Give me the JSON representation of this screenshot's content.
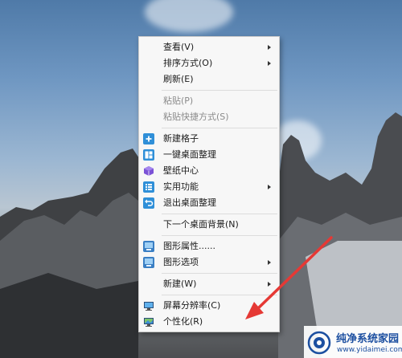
{
  "menu": {
    "items": [
      {
        "label": "查看(V)"
      },
      {
        "label": "排序方式(O)"
      },
      {
        "label": "刷新(E)"
      },
      {
        "label": "粘贴(P)"
      },
      {
        "label": "粘贴快捷方式(S)"
      },
      {
        "label": "新建格子"
      },
      {
        "label": "一键桌面整理"
      },
      {
        "label": "壁纸中心"
      },
      {
        "label": "实用功能"
      },
      {
        "label": "退出桌面整理"
      },
      {
        "label": "下一个桌面背景(N)"
      },
      {
        "label": "图形属性......"
      },
      {
        "label": "图形选项"
      },
      {
        "label": "新建(W)"
      },
      {
        "label": "屏幕分辨率(C)"
      },
      {
        "label": "个性化(R)"
      }
    ]
  },
  "icons": {
    "new_grid": "plus-square-icon",
    "desktop_organize": "layout-grid-icon",
    "wallpaper_center": "cube-icon",
    "utilities": "list-icon",
    "exit_organize": "undo-icon",
    "graphics_properties": "graphics-icon",
    "graphics_options": "graphics-icon",
    "screen_resolution": "monitor-icon",
    "personalize": "monitor-personalize-icon"
  },
  "colors": {
    "menu_bg": "#f7f7f7",
    "icon_blue": "#2f8fd8",
    "icon_purple": "#7b52d6",
    "annotation_arrow": "#e53935",
    "watermark_blue": "#1c4fa0"
  },
  "watermark": {
    "title": "纯净系统家园",
    "url": "www.yidaimei.com"
  }
}
